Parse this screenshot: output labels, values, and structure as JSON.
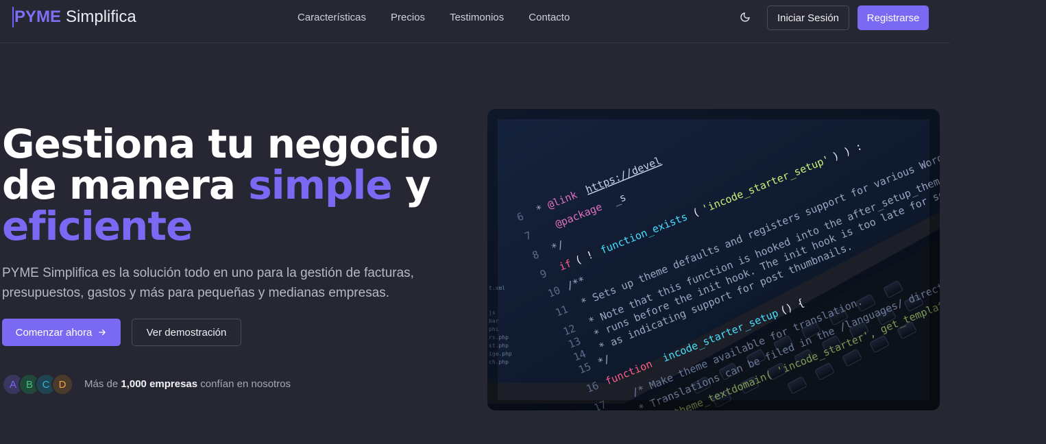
{
  "brand": {
    "name_strong": "PYME",
    "name_rest": "Simplifica"
  },
  "nav": {
    "items": [
      "Características",
      "Precios",
      "Testimonios",
      "Contacto"
    ]
  },
  "header": {
    "theme_icon": "moon-icon",
    "login_label": "Iniciar Sesión",
    "register_label": "Registrarse"
  },
  "hero": {
    "title_line1": "Gestiona tu negocio",
    "title_line2_pre": "de manera ",
    "title_line2_accent": "simple",
    "title_line2_post": " y",
    "title_line3_accent": "eficiente",
    "description": "PYME Simplifica es la solución todo en uno para la gestión de facturas, presupuestos, gastos y más para pequeñas y medianas empresas.",
    "cta_primary": "Comenzar ahora",
    "cta_primary_icon": "arrow-right-icon",
    "cta_secondary": "Ver demostración",
    "avatars": [
      {
        "letter": "A",
        "color": "#7a6af3",
        "bg": "#3a3660"
      },
      {
        "letter": "B",
        "color": "#3fc27b",
        "bg": "#1f4a3a"
      },
      {
        "letter": "C",
        "color": "#3ab5d6",
        "bg": "#1e4452"
      },
      {
        "letter": "D",
        "color": "#f0a24a",
        "bg": "#4a3a2a"
      }
    ],
    "social_pre": "Más de ",
    "social_strong": "1,000 empresas",
    "social_post": " confían en nosotros",
    "image_alt": "code-on-laptop-screen"
  },
  "colors": {
    "background": "#262733",
    "accent": "#7a6af3"
  }
}
